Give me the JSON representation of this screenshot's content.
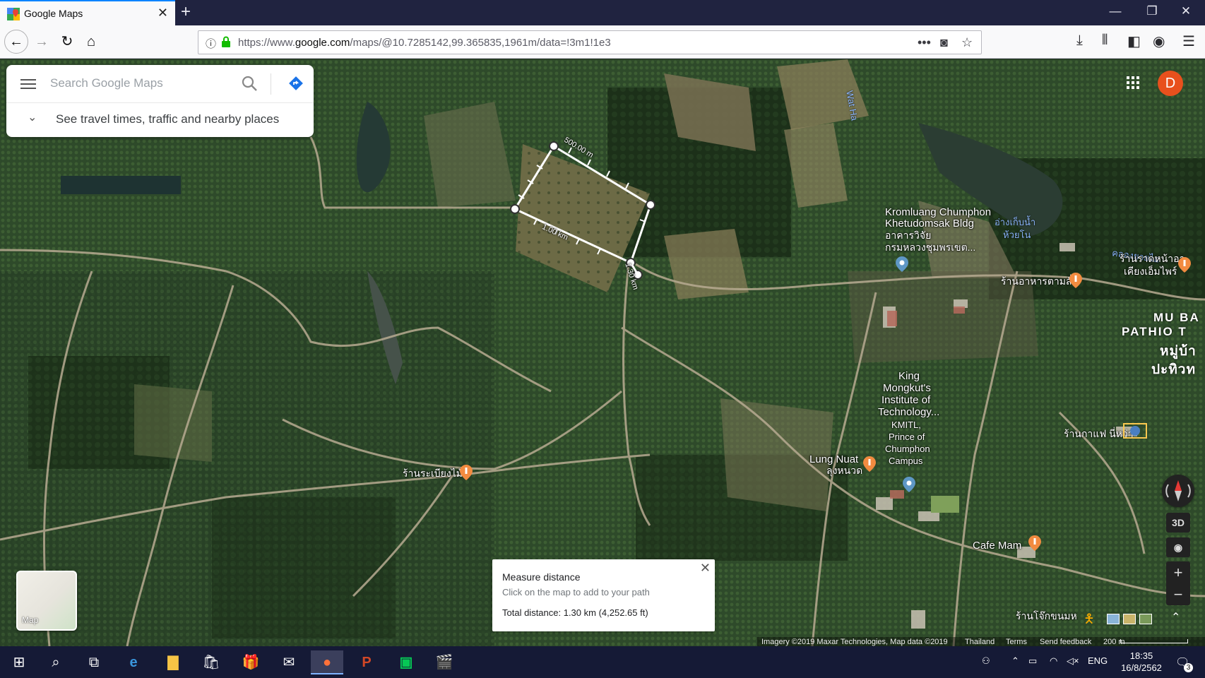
{
  "browser": {
    "tab_title": "Google Maps",
    "url_prefix": "https://www.",
    "url_domain": "google.com",
    "url_path": "/maps/@10.7285142,99.365835,1961m/data=!3m1!1e3"
  },
  "search": {
    "placeholder": "Search Google Maps",
    "travel_text": "See travel times, traffic and nearby places"
  },
  "user": {
    "avatar_letter": "D"
  },
  "measure": {
    "segment_labels": [
      "500.00 m",
      "1.00 km",
      "1.30 km"
    ],
    "card_title": "Measure distance",
    "card_subtitle": "Click on the map to add to your path",
    "total_distance": "Total distance: 1.30 km (4,252.65 ft)"
  },
  "places": [
    {
      "id": "kromluang",
      "lines": [
        "Kromluang Chumphon",
        "Khetudomsak Bldg",
        "อาคารวิจัย",
        "กรมหลวงชุมพรเขต..."
      ]
    },
    {
      "id": "kmitl",
      "lines": [
        "King",
        "Mongkut's",
        "Institute of",
        "Technology...",
        "KMITL,",
        "Prince of",
        "Chumphon",
        "Campus"
      ]
    },
    {
      "id": "lung_nuat",
      "lines": [
        "Lung Nuat",
        "ลุงหนวด"
      ]
    },
    {
      "id": "cafe_mam",
      "lines": [
        "Cafe Mam"
      ]
    },
    {
      "id": "rian_bueang",
      "lines": [
        "ร้านระเบียงไม้"
      ]
    },
    {
      "id": "rim_tham",
      "lines": [
        "ร้านอาหารตามสั่ง"
      ]
    },
    {
      "id": "rim_na",
      "lines": [
        "ร้านราดหน้าอา",
        "เคียงเอ็มไพร์"
      ]
    },
    {
      "id": "kafe",
      "lines": [
        "ร้านกาแฟ นี่หว่า"
      ]
    },
    {
      "id": "jok",
      "lines": [
        "ร้านโจ๊กขนมห"
      ]
    }
  ],
  "area_labels": [
    "MU BA",
    "PATHIO T",
    "หมู่บ้า",
    "ปะทิวท"
  ],
  "water_labels": [
    "Wat Ha",
    "อ่างเก็บน้ำ",
    "ห้วยโน",
    "คลองยายไอ"
  ],
  "controls": {
    "layer_label": "Map",
    "view_3d": "3D",
    "zoom_in": "+",
    "zoom_out": "−"
  },
  "footer": {
    "imagery": "Imagery ©2019 Maxar Technologies, Map data ©2019",
    "country": "Thailand",
    "terms": "Terms",
    "feedback": "Send feedback",
    "scale": "200 m"
  },
  "taskbar": {
    "lang": "ENG",
    "time": "18:35",
    "date": "16/8/2562",
    "notif_count": "3"
  },
  "colors": {
    "accent_blue": "#0a84ff",
    "avatar": "#e8501d",
    "taskbar": "#151a36",
    "tabstrip": "#202340"
  }
}
